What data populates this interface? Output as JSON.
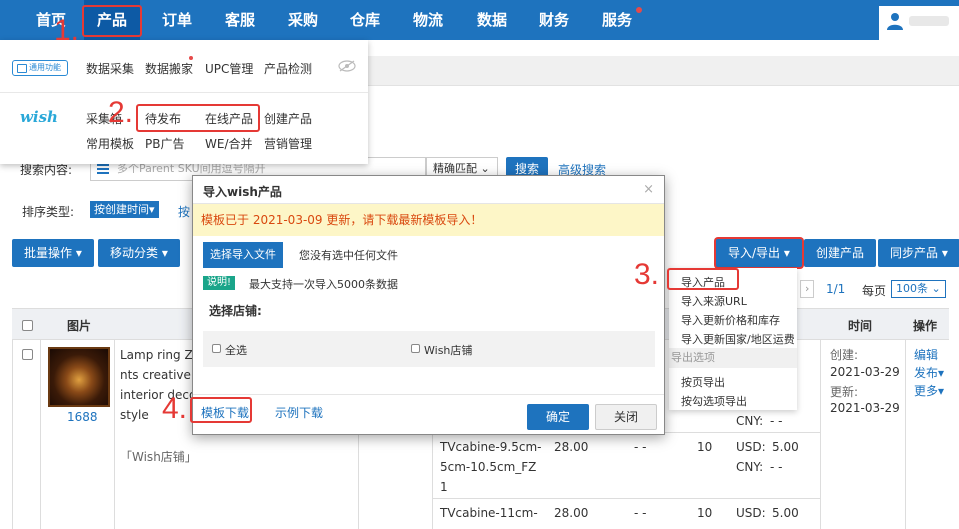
{
  "nav": {
    "items": [
      "首页",
      "产品",
      "订单",
      "客服",
      "采购",
      "仓库",
      "物流",
      "数据",
      "财务",
      "服务"
    ]
  },
  "menu": {
    "common_logo": "通用功能",
    "common_items": [
      "数据采集",
      "数据搬家",
      "UPC管理",
      "产品检测"
    ],
    "wish_logo": "wish",
    "wish_row1": [
      "采集箱",
      "待发布",
      "在线产品",
      "创建产品"
    ],
    "wish_row2": [
      "常用模板",
      "PB广告",
      "WE/合并",
      "营销管理"
    ]
  },
  "search": {
    "label": "搜索内容:",
    "placeholder": "多个Parent SKU间用逗号隔开",
    "match": "精确匹配",
    "search_btn": "搜索",
    "advanced": "高级搜索"
  },
  "sort": {
    "label": "排序类型:",
    "value": "按创建时间",
    "extra": "按"
  },
  "toolbar": {
    "batch": "批量操作",
    "move": "移动分类",
    "import_export": "导入/导出",
    "create": "创建产品",
    "sync": "同步产品"
  },
  "pager": {
    "page": "1/1",
    "per_page_label": "每页",
    "per_page": "100条"
  },
  "dropdown": {
    "items": [
      "导入产品",
      "导入来源URL",
      "导入更新价格和库存",
      "导入更新国家/地区运费"
    ],
    "section": "导出选项",
    "export_items": [
      "按页导出",
      "按勾选项导出"
    ]
  },
  "table": {
    "headers": {
      "image": "图片",
      "time": "时间",
      "action": "操作"
    },
    "row": {
      "id": "1688",
      "title_lines": [
        "Lamp ring Zen",
        "nts creative livi",
        "interior decora",
        "style"
      ],
      "shop": "「Wish店铺」",
      "created_label": "创建:",
      "created": "2021-03-29",
      "updated_label": "更新:",
      "updated": "2021-03-29",
      "actions": [
        "编辑",
        "发布",
        "更多"
      ]
    },
    "variants": [
      {
        "sku_lines": [
          "TVcabine-9.5cm-",
          "5cm-10.5cm_FZ",
          "1"
        ],
        "price": "28.00",
        "dash": "- -",
        "stock": "10",
        "usd": "USD:",
        "usd_val": "5.00",
        "cny": "CNY:",
        "cny_val": "- -"
      },
      {
        "sku_lines": [
          "TVcabine-11cm-"
        ],
        "price": "28.00",
        "dash": "- -",
        "stock": "10",
        "usd": "USD:",
        "usd_val": "5.00"
      }
    ],
    "cny_above": "CNY:",
    "cny_above_val": "- -"
  },
  "modal": {
    "title": "导入wish产品",
    "warning": "模板已于 2021-03-09 更新，请下载最新模板导入！",
    "file_btn": "选择导入文件",
    "no_file": "您没有选中任何文件",
    "tip_badge": "说明!",
    "tip_text": "最大支持一次导入5000条数据",
    "shop_label": "选择店铺:",
    "select_all": "全选",
    "shop_name": "Wish店铺",
    "template_dl": "模板下载",
    "example_dl": "示例下载",
    "ok": "确定",
    "close": "关闭"
  },
  "annotations": [
    "1.",
    "2.",
    "3.",
    "4."
  ],
  "colors": {
    "brand": "#1e73be",
    "annotation": "#e53935",
    "warning_bg": "#fdf6c7"
  }
}
